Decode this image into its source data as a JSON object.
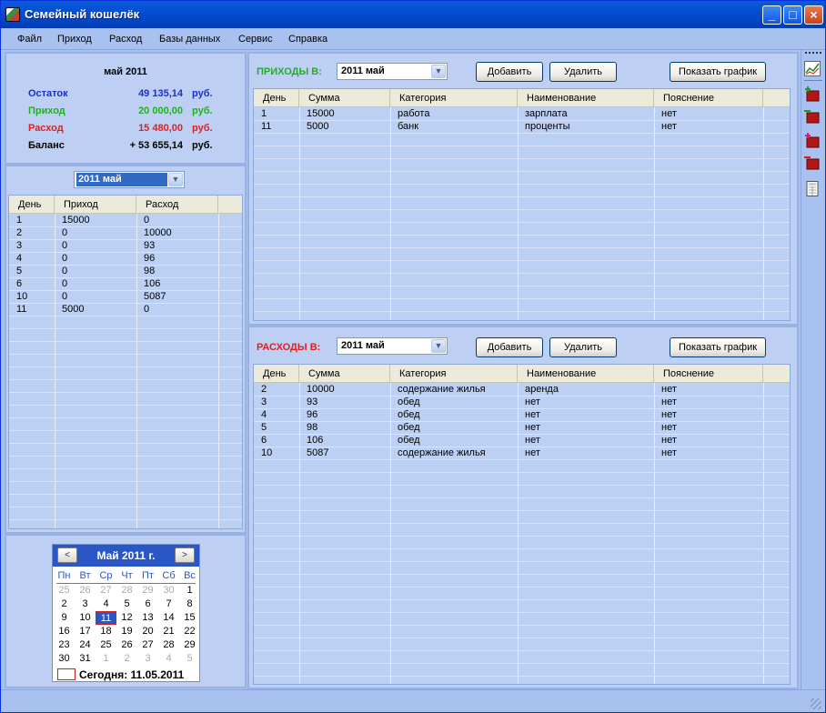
{
  "app": {
    "title": "Семейный кошелёк"
  },
  "menu": [
    "Файл",
    "Приход",
    "Расход",
    "Базы данных",
    "Сервис",
    "Справка"
  ],
  "summary": {
    "period": "май 2011",
    "rows": [
      {
        "label": "Остаток",
        "value": "49 135,14",
        "unit": "руб.",
        "color": "#1b2fd0"
      },
      {
        "label": "Приход",
        "value": "20 000,00",
        "unit": "руб.",
        "color": "#20b020"
      },
      {
        "label": "Расход",
        "value": "15 480,00",
        "unit": "руб.",
        "color": "#e02020"
      },
      {
        "label": "Баланс",
        "value": "+ 53 655,14",
        "unit": "руб.",
        "color": "#000000"
      }
    ]
  },
  "left": {
    "month_select": "2011 май",
    "headers": [
      "День",
      "Приход",
      "Расход"
    ],
    "rows": [
      [
        "1",
        "15000",
        "0"
      ],
      [
        "2",
        "0",
        "10000"
      ],
      [
        "3",
        "0",
        "93"
      ],
      [
        "4",
        "0",
        "96"
      ],
      [
        "5",
        "0",
        "98"
      ],
      [
        "6",
        "0",
        "106"
      ],
      [
        "10",
        "0",
        "5087"
      ],
      [
        "11",
        "5000",
        "0"
      ]
    ]
  },
  "income": {
    "label": "ПРИХОДЫ В:",
    "label_color": "#20b020",
    "month_select": "2011 май",
    "add": "Добавить",
    "delete": "Удалить",
    "chart": "Показать график",
    "headers": [
      "День",
      "Сумма",
      "Категория",
      "Наименование",
      "Пояснение"
    ],
    "rows": [
      [
        "1",
        "15000",
        "работа",
        "зарплата",
        "нет"
      ],
      [
        "11",
        "5000",
        "банк",
        "проценты",
        "нет"
      ]
    ]
  },
  "expense": {
    "label": "РАСХОДЫ В:",
    "label_color": "#e02020",
    "month_select": "2011 май",
    "add": "Добавить",
    "delete": "Удалить",
    "chart": "Показать график",
    "headers": [
      "День",
      "Сумма",
      "Категория",
      "Наименование",
      "Пояснение"
    ],
    "rows": [
      [
        "2",
        "10000",
        "содержание жилья",
        "аренда",
        "нет"
      ],
      [
        "3",
        "93",
        "обед",
        "нет",
        "нет"
      ],
      [
        "4",
        "96",
        "обед",
        "нет",
        "нет"
      ],
      [
        "5",
        "98",
        "обед",
        "нет",
        "нет"
      ],
      [
        "6",
        "106",
        "обед",
        "нет",
        "нет"
      ],
      [
        "10",
        "5087",
        "содержание жилья",
        "нет",
        "нет"
      ]
    ]
  },
  "calendar": {
    "title": "Май 2011 г.",
    "prev": "<",
    "next": ">",
    "dow": [
      "Пн",
      "Вт",
      "Ср",
      "Чт",
      "Пт",
      "Сб",
      "Вс"
    ],
    "weeks": [
      [
        [
          "25",
          "o"
        ],
        [
          "26",
          "o"
        ],
        [
          "27",
          "o"
        ],
        [
          "28",
          "o"
        ],
        [
          "29",
          "o"
        ],
        [
          "30",
          "o"
        ],
        [
          "1",
          ""
        ]
      ],
      [
        [
          "2",
          ""
        ],
        [
          "3",
          ""
        ],
        [
          "4",
          ""
        ],
        [
          "5",
          ""
        ],
        [
          "6",
          ""
        ],
        [
          "7",
          ""
        ],
        [
          "8",
          ""
        ]
      ],
      [
        [
          "9",
          ""
        ],
        [
          "10",
          ""
        ],
        [
          "11",
          "s"
        ],
        [
          "12",
          ""
        ],
        [
          "13",
          ""
        ],
        [
          "14",
          ""
        ],
        [
          "15",
          ""
        ]
      ],
      [
        [
          "16",
          ""
        ],
        [
          "17",
          ""
        ],
        [
          "18",
          ""
        ],
        [
          "19",
          ""
        ],
        [
          "20",
          ""
        ],
        [
          "21",
          ""
        ],
        [
          "22",
          ""
        ]
      ],
      [
        [
          "23",
          ""
        ],
        [
          "24",
          ""
        ],
        [
          "25",
          ""
        ],
        [
          "26",
          ""
        ],
        [
          "27",
          ""
        ],
        [
          "28",
          ""
        ],
        [
          "29",
          ""
        ]
      ],
      [
        [
          "30",
          ""
        ],
        [
          "31",
          ""
        ],
        [
          "1",
          "o"
        ],
        [
          "2",
          "o"
        ],
        [
          "3",
          "o"
        ],
        [
          "4",
          "o"
        ],
        [
          "5",
          "o"
        ]
      ]
    ],
    "today": "Сегодня: 11.05.2011"
  },
  "toolbar_icons": [
    "chart-icon",
    "add-income-icon",
    "delete-income-icon",
    "add-expense-icon",
    "delete-expense-icon",
    "calculator-icon"
  ]
}
